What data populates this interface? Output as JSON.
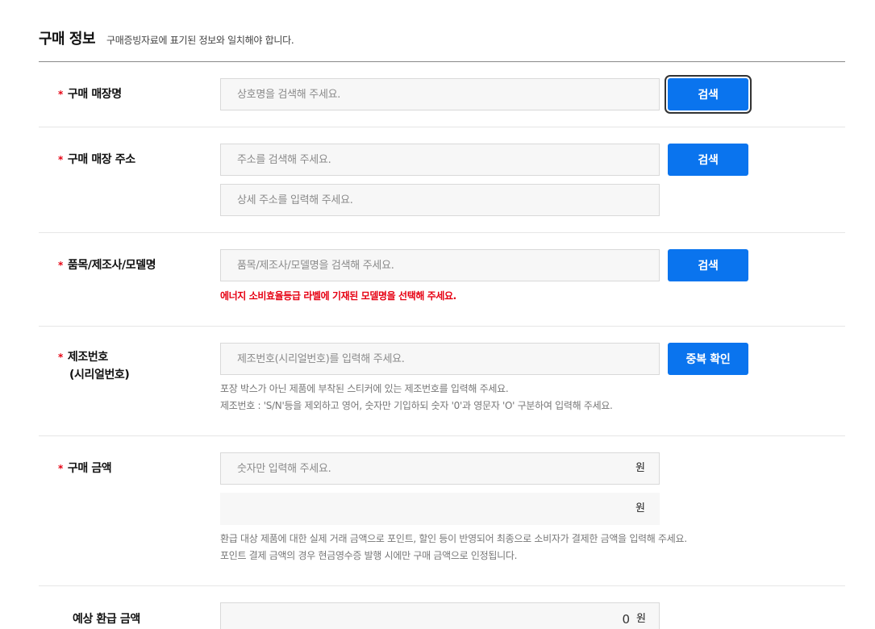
{
  "header": {
    "title": "구매 정보",
    "subtitle": "구매증빙자료에 표기된 정보와 일치해야 합니다."
  },
  "fields": {
    "store_name": {
      "label": "구매 매장명",
      "placeholder": "상호명을 검색해 주세요.",
      "button": "검색"
    },
    "store_address": {
      "label": "구매 매장 주소",
      "placeholder": "주소를 검색해 주세요.",
      "detail_placeholder": "상세 주소를 입력해 주세요.",
      "button": "검색"
    },
    "product": {
      "label": "품목/제조사/모델명",
      "placeholder": "품목/제조사/모델명을 검색해 주세요.",
      "button": "검색",
      "warning": "에너지 소비효율등급 라벨에 기재된 모델명을 선택해 주세요."
    },
    "serial": {
      "label_line1": "제조번호",
      "label_line2": "(시리얼번호)",
      "placeholder": "제조번호(시리얼번호)를 입력해 주세요.",
      "button": "중복 확인",
      "hint_line1": "포장 박스가 아닌 제품에 부착된 스티커에 있는 제조번호를 입력해 주세요.",
      "hint_line2": "제조번호 : 'S/N'등을 제외하고 영어, 숫자만 기입하되 숫자 '0'과 영문자 'O' 구분하여 입력해 주세요."
    },
    "price": {
      "label": "구매 금액",
      "placeholder": "숫자만 입력해 주세요.",
      "unit": "원",
      "unit2": "원",
      "hint_line1": "환급 대상 제품에 대한 실제 거래 금액으로 포인트, 할인 등이 반영되어 최종으로 소비자가 결제한 금액을 입력해 주세요.",
      "hint_line2": "포인트 결제 금액의 경우 현금영수증 발행 시에만 구매 금액으로 인정됩니다."
    },
    "refund": {
      "label": "예상 환급 금액",
      "value": "0",
      "unit": "원"
    }
  },
  "colors": {
    "accent": "#0a74ee",
    "required": "#e60012",
    "field_bg": "#f7f7f7"
  }
}
